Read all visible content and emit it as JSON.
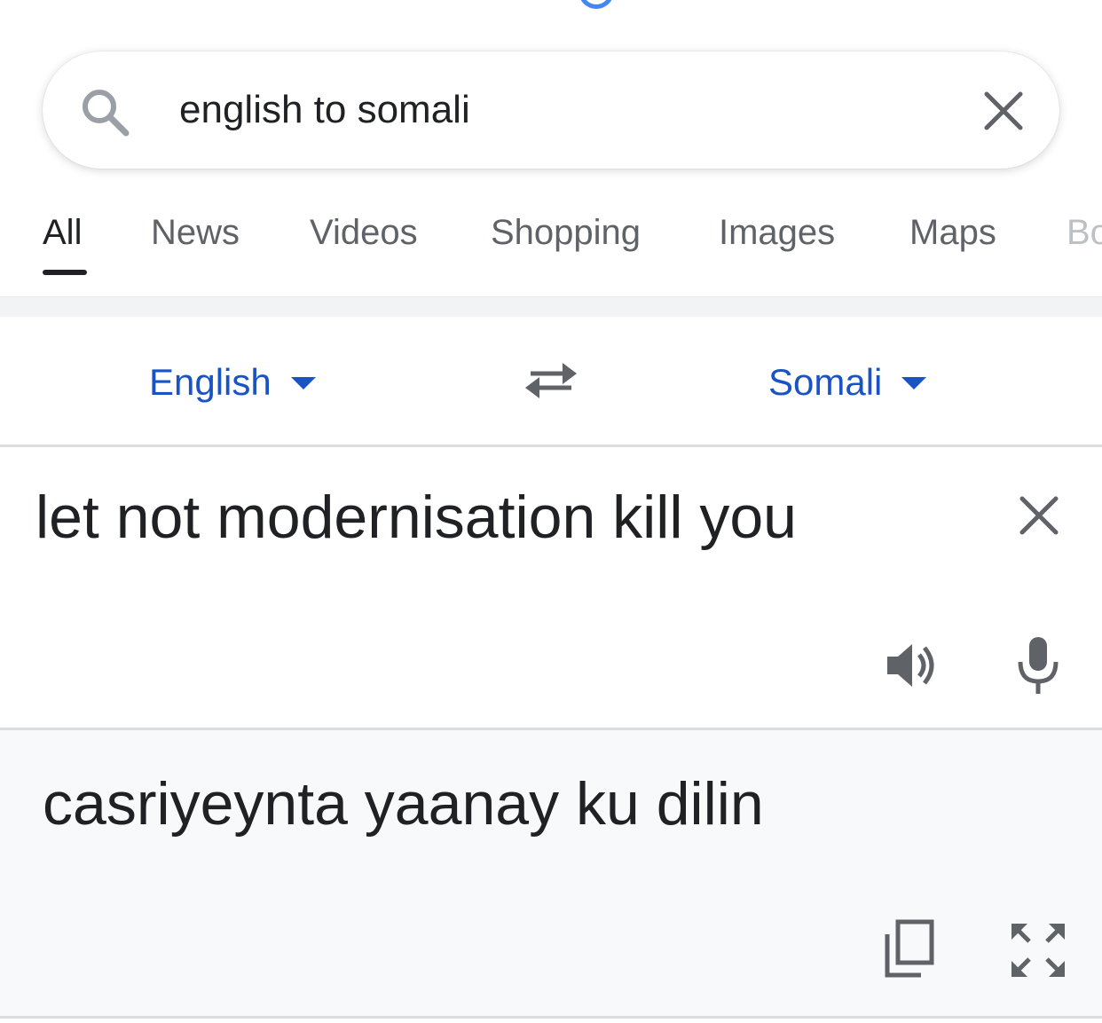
{
  "search": {
    "query": "english to somali",
    "icons": {
      "search": "search-icon",
      "clear": "close-icon"
    }
  },
  "tabs": [
    {
      "label": "All",
      "active": true
    },
    {
      "label": "News"
    },
    {
      "label": "Videos"
    },
    {
      "label": "Shopping"
    },
    {
      "label": "Images"
    },
    {
      "label": "Maps"
    },
    {
      "label": "Bo"
    }
  ],
  "translator": {
    "source_language": "English",
    "target_language": "Somali",
    "swap_icon": "swap-icon",
    "source_text": "let not modernisation kill you",
    "target_text": "casriyeynta yaanay ku dilin",
    "icons": {
      "source_clear": "close-icon",
      "listen": "speaker-icon",
      "voice_input": "mic-icon",
      "copy": "copy-icon",
      "fullscreen": "expand-icon"
    }
  },
  "colors": {
    "accent_blue": "#1a53c4",
    "text_primary": "#202124",
    "text_secondary": "#5f6368",
    "icon_gray": "#5f6368",
    "result_background": "#f8f9fa"
  }
}
